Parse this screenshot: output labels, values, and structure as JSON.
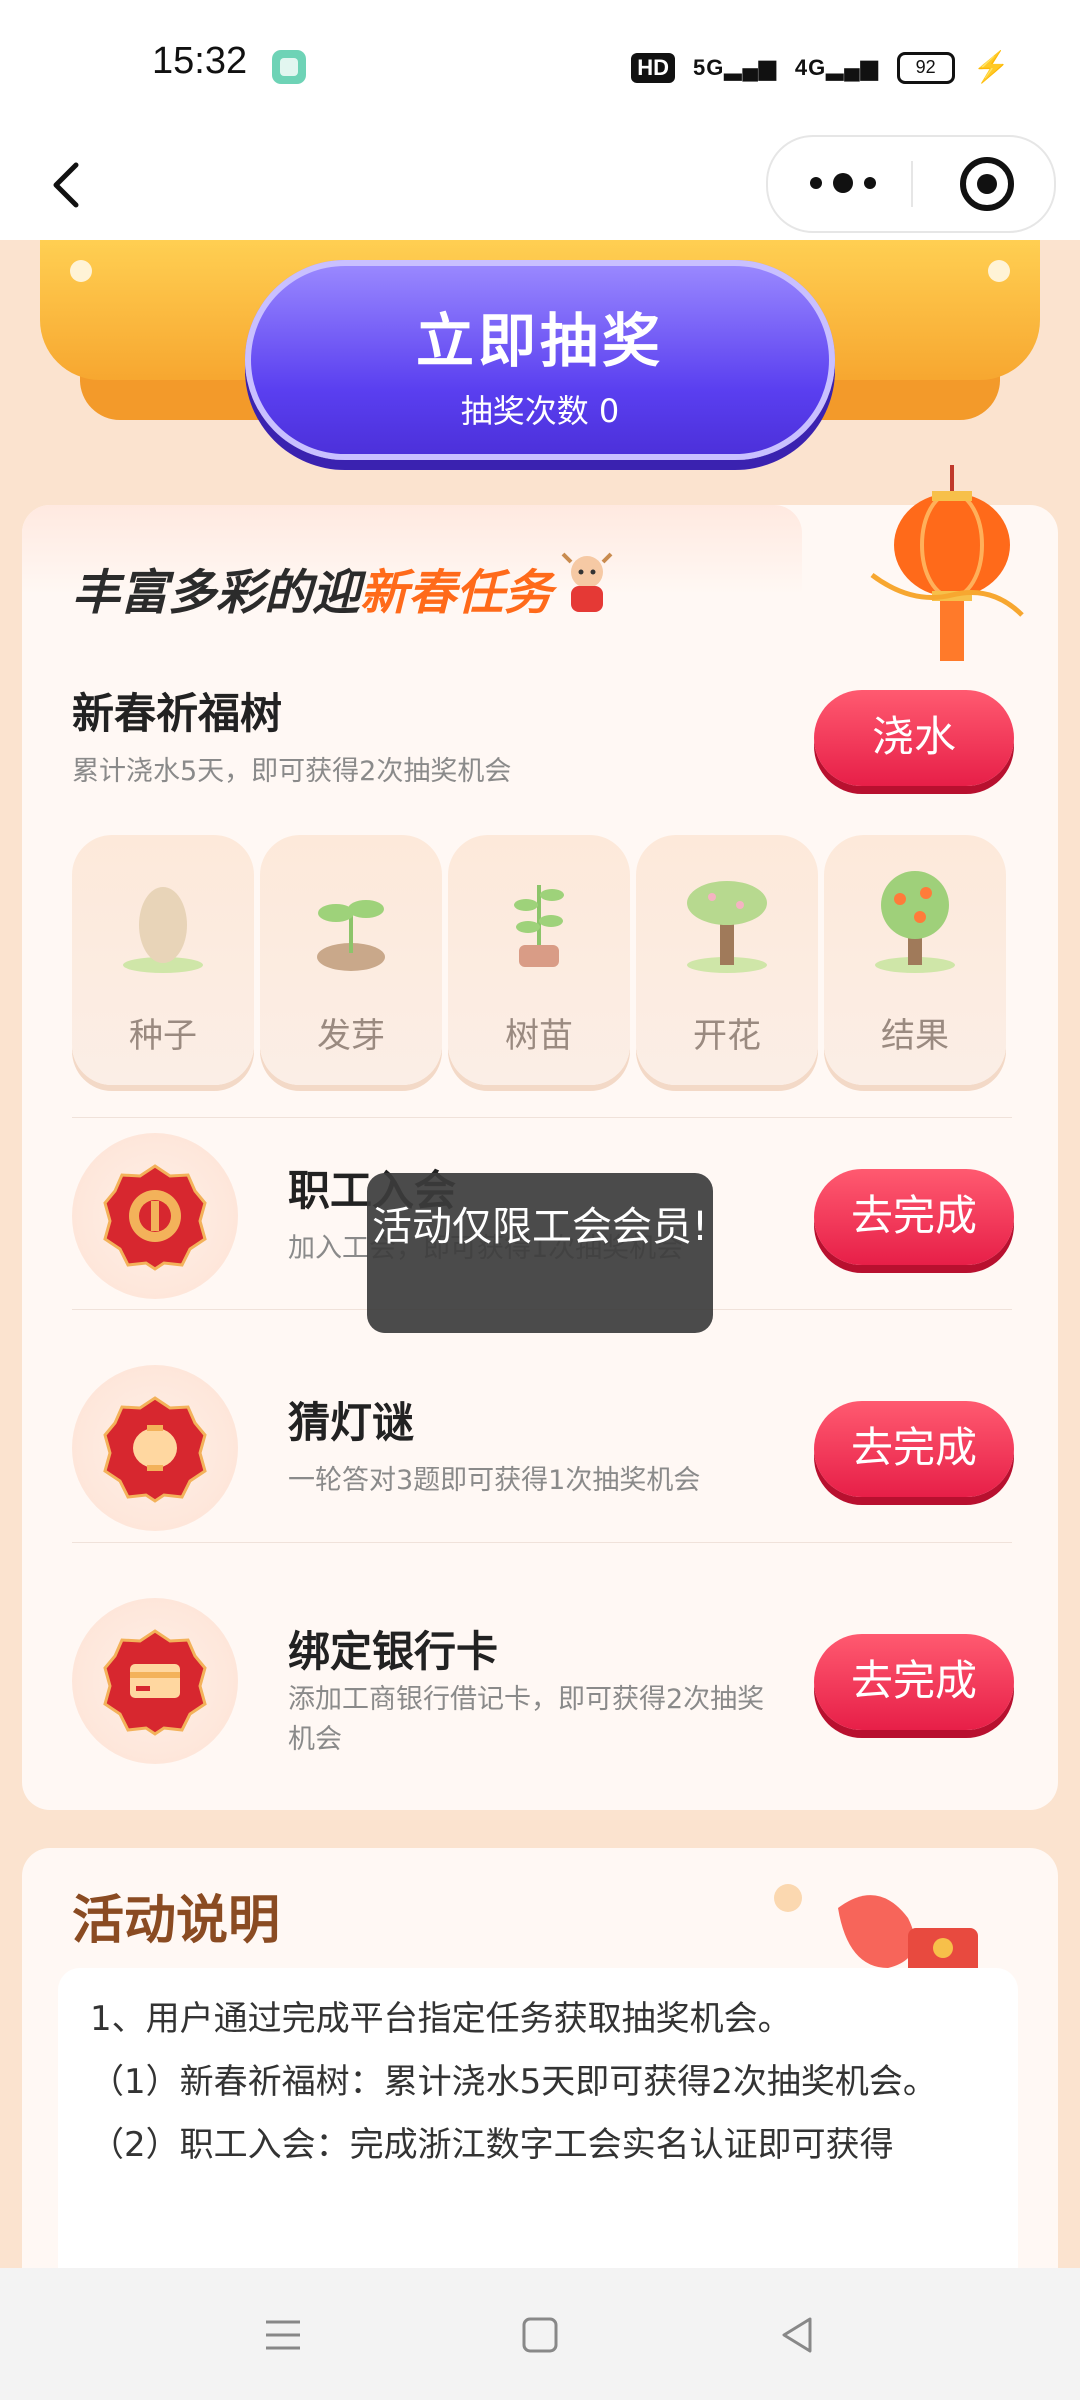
{
  "status_bar": {
    "time": "15:32",
    "hd": "HD",
    "signal_1": "5G",
    "signal_2": "4G",
    "battery": "92"
  },
  "nav": {
    "back_icon": "chevron-left-icon",
    "more_icon": "more-dots-icon",
    "close_icon": "target-icon"
  },
  "lottery": {
    "title": "立即抽奖",
    "count_label": "抽奖次数 0"
  },
  "tasks": {
    "section_title_a": "丰富多彩的迎",
    "section_title_b": "新春任务",
    "tree": {
      "title": "新春祈福树",
      "desc": "累计浇水5天，即可获得2次抽奖机会",
      "button": "浇水",
      "stages": [
        "种子",
        "发芽",
        "树苗",
        "开花",
        "结果"
      ]
    },
    "items": [
      {
        "title": "职工入会",
        "desc": "加入工会，即可获得1次抽奖机会",
        "button": "去完成",
        "icon": "union-badge-icon"
      },
      {
        "title": "猜灯谜",
        "desc": "一轮答对3题即可获得1次抽奖机会",
        "button": "去完成",
        "icon": "lantern-icon"
      },
      {
        "title": "绑定银行卡",
        "desc": "添加工商银行借记卡，即可获得2次抽奖机会",
        "button": "去完成",
        "icon": "bank-card-icon"
      }
    ]
  },
  "toast": {
    "text": "活动仅限工会会员!"
  },
  "rules": {
    "title": "活动说明",
    "lines": [
      "1、用户通过完成平台指定任务获取抽奖机会。",
      "（1）新春祈福树：累计浇水5天即可获得2次抽奖机会。",
      "（2）职工入会：完成浙江数字工会实名认证即可获得"
    ]
  },
  "colors": {
    "page_bg": "#fbe3cf",
    "primary_red": "#e71f48",
    "lottery_purple": "#5a3ff0",
    "highlight_orange": "#ff6a1a"
  }
}
